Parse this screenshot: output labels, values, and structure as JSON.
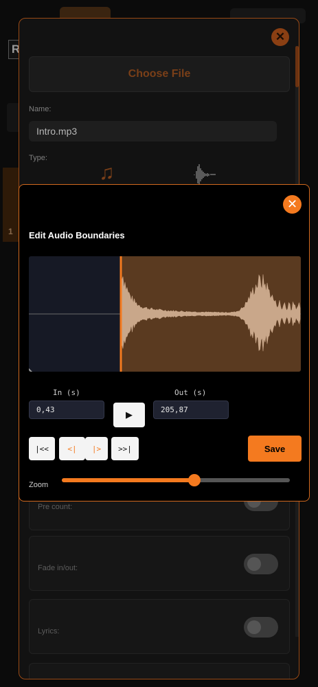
{
  "background": {
    "letter": "R",
    "side_text": "1"
  },
  "file_dialog": {
    "close_glyph": "✕",
    "choose_file_label": "Choose File",
    "name_label": "Name:",
    "name_value": "Intro.mp3",
    "type_label": "Type:",
    "type_icons": [
      "music-note-icon",
      "waveform-icon"
    ],
    "toggles": [
      {
        "label": "Pre count:",
        "on": false
      },
      {
        "label": "Fade in/out:",
        "on": false
      },
      {
        "label": "Lyrics:",
        "on": false
      }
    ]
  },
  "editor": {
    "title": "Edit Audio Boundaries",
    "close_glyph": "✕",
    "in_label": "In (s)",
    "in_value": "0,43",
    "out_label": "Out (s)",
    "out_value": "205,87",
    "play_glyph": "▶",
    "nav_buttons": [
      "|<<",
      "<|",
      "|>",
      ">>|"
    ],
    "save_label": "Save",
    "zoom_label": "Zoom",
    "zoom_level": 0.58,
    "colors": {
      "accent": "#f47a1f",
      "selection": "#5a3a20",
      "waveform": "#c9a78a"
    }
  }
}
